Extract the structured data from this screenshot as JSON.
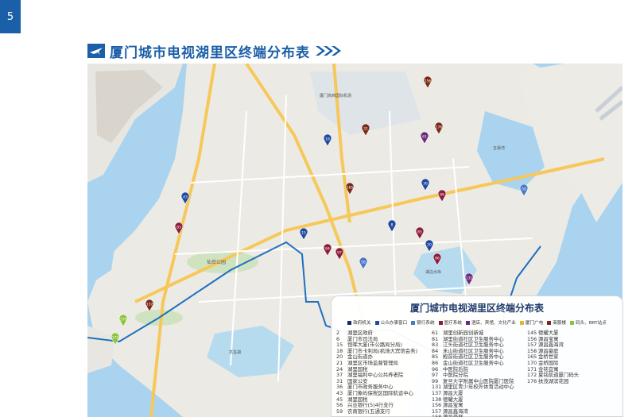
{
  "page_number": "5",
  "title": "厦门城市电视湖里区终端分布表",
  "legend": {
    "title": "厦门城市电视湖里区终端分布表",
    "categories": [
      {
        "label": "政府机关",
        "color": "#1b2a6b"
      },
      {
        "label": "公众办事窗口",
        "color": "#1f4aa0"
      },
      {
        "label": "银行系统",
        "color": "#4a78c8"
      },
      {
        "label": "医疗系统",
        "color": "#8b1c3a"
      },
      {
        "label": "酒店、宾馆、文化产业",
        "color": "#6a2a7a"
      },
      {
        "label": "厦门广电",
        "color": "#e0b82a"
      },
      {
        "label": "商服楼",
        "color": "#7a2a14"
      },
      {
        "label": "码头、BRT站点",
        "color": "#8ac43a"
      }
    ],
    "columns": [
      [
        {
          "n": "2",
          "t": "湖里区政府"
        },
        {
          "n": "6",
          "t": "厦门市司法局"
        },
        {
          "n": "15",
          "t": "恒晖大厦(市公路局分局)"
        },
        {
          "n": "18",
          "t": "厦门市卡利局(机场大宾馆会务)"
        },
        {
          "n": "20",
          "t": "金山街道办"
        },
        {
          "n": "21",
          "t": "湖里区市场监督管理局"
        },
        {
          "n": "24",
          "t": "湖里国税"
        },
        {
          "n": "37",
          "t": "湖里福利中心公共养老院"
        },
        {
          "n": "31",
          "t": "国家公安"
        },
        {
          "n": "36",
          "t": "厦门市政务服务中心"
        },
        {
          "n": "43",
          "t": "厦门象屿保税区国际航运中心"
        },
        {
          "n": "45",
          "t": "湖里国税"
        },
        {
          "n": "56",
          "t": "兴业银行(5)4行支行"
        },
        {
          "n": "59",
          "t": "农商银行(五通支行"
        }
      ],
      [
        {
          "n": "61",
          "t": "湖里创新园创新城"
        },
        {
          "n": "81",
          "t": "湖里街道社区卫生服务中心"
        },
        {
          "n": "83",
          "t": "江头街道社区卫生服务中心"
        },
        {
          "n": "84",
          "t": "禾山街道社区卫生服务中心"
        },
        {
          "n": "85",
          "t": "殿前街道社区卫生服务中心"
        },
        {
          "n": "86",
          "t": "金山街道社区卫生服务中心"
        },
        {
          "n": "96",
          "t": "中医院后院"
        },
        {
          "n": "97",
          "t": "中医院分院"
        },
        {
          "n": "99",
          "t": "复旦大学附属中山医院厦门医院"
        },
        {
          "n": "131",
          "t": "湖里区青少年校外体育活动中心"
        },
        {
          "n": "137",
          "t": "源昌大厦"
        },
        {
          "n": "138",
          "t": "德耀大厦"
        },
        {
          "n": "156",
          "t": "源昌宝寓"
        },
        {
          "n": "157",
          "t": "源昌鑫海湾"
        },
        {
          "n": "158",
          "t": "源昌豪庭"
        }
      ],
      [
        {
          "n": "145",
          "t": "德耀大厦"
        },
        {
          "n": "156",
          "t": "源昌宝寓"
        },
        {
          "n": "157",
          "t": "源昌鑫海湾"
        },
        {
          "n": "158",
          "t": "源昌豪庭"
        },
        {
          "n": "165",
          "t": "金桥世家"
        },
        {
          "n": "170",
          "t": "金桥国际"
        },
        {
          "n": "171",
          "t": "金铭宜寓"
        },
        {
          "n": "172",
          "t": "夏铭航道厦门码头"
        },
        {
          "n": "176",
          "t": "扶茂湖滨花园"
        }
      ]
    ]
  },
  "map_labels": [
    {
      "t": "厦门高崎国际机场"
    },
    {
      "t": "仙岳公园"
    },
    {
      "t": "湖边水库"
    },
    {
      "t": "筼筜湖"
    },
    {
      "t": "五缘湾"
    }
  ],
  "markers": [
    {
      "n": "156",
      "c": "#7a2a14"
    },
    {
      "n": "31",
      "c": "#7a2a14"
    },
    {
      "n": "18",
      "c": "#1f4aa0"
    },
    {
      "n": "61",
      "c": "#6a2a7a"
    },
    {
      "n": "43",
      "c": "#1f4aa0"
    },
    {
      "n": "83",
      "c": "#8b1c3a"
    },
    {
      "n": "15",
      "c": "#1f4aa0"
    },
    {
      "n": "165",
      "c": "#7a2a14"
    },
    {
      "n": "84",
      "c": "#8b1c3a"
    },
    {
      "n": "97",
      "c": "#8b1c3a"
    },
    {
      "n": "56",
      "c": "#4a78c8"
    },
    {
      "n": "131",
      "c": "#6a2a7a"
    },
    {
      "n": "85",
      "c": "#8b1c3a"
    },
    {
      "n": "20",
      "c": "#1f4aa0"
    },
    {
      "n": "86",
      "c": "#8b1c3a"
    },
    {
      "n": "59",
      "c": "#4a78c8"
    },
    {
      "n": "99",
      "c": "#8b1c3a"
    },
    {
      "n": "36",
      "c": "#1f4aa0"
    },
    {
      "n": "8",
      "c": "#1f4aa0"
    },
    {
      "n": "176",
      "c": "#7a2a14"
    },
    {
      "n": "170",
      "c": "#8ac43a"
    },
    {
      "n": "172",
      "c": "#8ac43a"
    },
    {
      "n": "137",
      "c": "#7a2a14"
    }
  ]
}
